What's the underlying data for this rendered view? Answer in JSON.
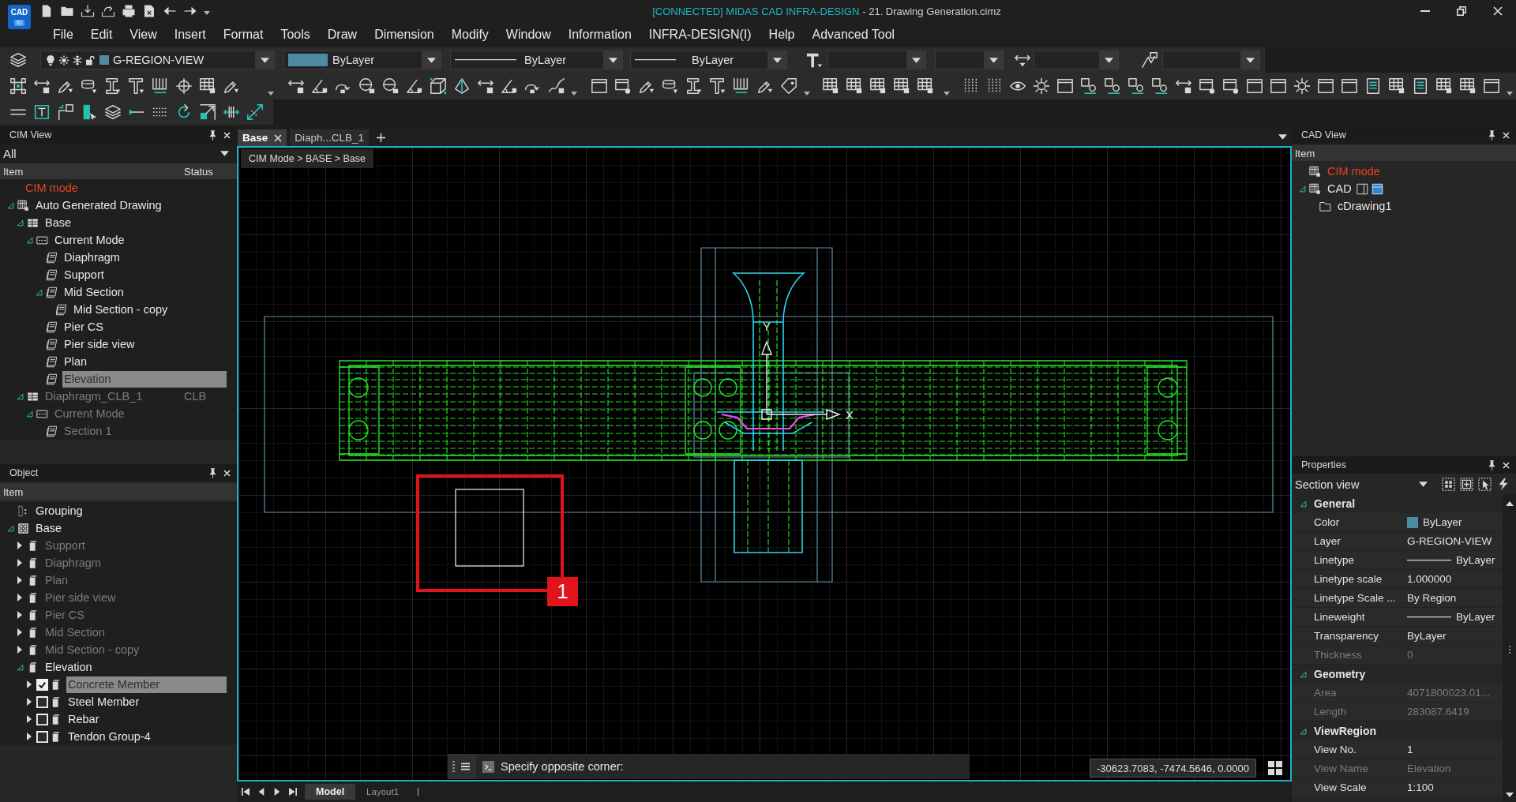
{
  "logo": {
    "text": "CAD",
    "subtext": "ID"
  },
  "window": {
    "app_title": "[CONNECTED] MIDAS CAD INFRA-DESIGN",
    "document_title": "- 21. Drawing Generation.cimz"
  },
  "menu": [
    "File",
    "Edit",
    "View",
    "Insert",
    "Format",
    "Tools",
    "Draw",
    "Dimension",
    "Modify",
    "Window",
    "Information",
    "INFRA-DESIGN(I)",
    "Help",
    "Advanced Tool"
  ],
  "style_toolbar": {
    "layer": "G-REGION-VIEW",
    "color_setting": "ByLayer",
    "linetype": "ByLayer",
    "lineweight": "ByLayer"
  },
  "cim_view": {
    "title": "CIM View",
    "filter": "All",
    "columns": [
      "Item",
      "Status"
    ],
    "items": [
      {
        "label": "CIM mode",
        "kind": "mode",
        "selected": false,
        "disabled": false
      },
      {
        "label": "Auto Generated Drawing",
        "kind": "drawing-set",
        "expanded": true,
        "selected": false,
        "disabled": false,
        "children": [
          {
            "label": "Base",
            "kind": "base",
            "expanded": true,
            "selected": false,
            "disabled": false,
            "children": [
              {
                "label": "Current Mode",
                "kind": "mode-folder",
                "expanded": true,
                "selected": false,
                "disabled": false,
                "children": [
                  {
                    "label": "Diaphragm",
                    "kind": "view",
                    "selected": false,
                    "disabled": false
                  },
                  {
                    "label": "Support",
                    "kind": "view",
                    "selected": false,
                    "disabled": false
                  },
                  {
                    "label": "Mid Section",
                    "kind": "view",
                    "expanded": true,
                    "selected": false,
                    "disabled": false,
                    "children": [
                      {
                        "label": "Mid Section - copy",
                        "kind": "view",
                        "selected": false,
                        "disabled": false
                      }
                    ]
                  },
                  {
                    "label": "Pier CS",
                    "kind": "view",
                    "selected": false,
                    "disabled": false
                  },
                  {
                    "label": "Pier side view",
                    "kind": "view",
                    "selected": false,
                    "disabled": false
                  },
                  {
                    "label": "Plan",
                    "kind": "view",
                    "selected": false,
                    "disabled": false
                  },
                  {
                    "label": "Elevation",
                    "kind": "view",
                    "selected": true,
                    "disabled": false
                  }
                ]
              }
            ]
          },
          {
            "label": "Diaphragm_CLB_1",
            "status": "CLB",
            "kind": "base",
            "expanded": true,
            "selected": false,
            "disabled": true,
            "children": [
              {
                "label": "Current Mode",
                "kind": "mode-folder",
                "expanded": true,
                "selected": false,
                "disabled": true,
                "children": [
                  {
                    "label": "Section 1",
                    "kind": "view",
                    "selected": false,
                    "disabled": true
                  }
                ]
              }
            ]
          }
        ]
      }
    ]
  },
  "object_panel": {
    "title": "Object",
    "columns": [
      "Item"
    ],
    "items": [
      {
        "label": "Grouping",
        "kind": "grouping",
        "selected": false,
        "disabled": false
      },
      {
        "label": "Base",
        "kind": "model",
        "expanded": true,
        "selected": false,
        "disabled": false,
        "children": [
          {
            "label": "Support",
            "kind": "object",
            "expanded": false,
            "selected": false,
            "disabled": true
          },
          {
            "label": "Diaphragm",
            "kind": "object",
            "expanded": false,
            "selected": false,
            "disabled": true
          },
          {
            "label": "Plan",
            "kind": "object",
            "expanded": false,
            "selected": false,
            "disabled": true
          },
          {
            "label": "Pier side view",
            "kind": "object",
            "expanded": false,
            "selected": false,
            "disabled": true
          },
          {
            "label": "Pier CS",
            "kind": "object",
            "expanded": false,
            "selected": false,
            "disabled": true
          },
          {
            "label": "Mid Section",
            "kind": "object",
            "expanded": false,
            "selected": false,
            "disabled": true
          },
          {
            "label": "Mid Section - copy",
            "kind": "object",
            "expanded": false,
            "selected": false,
            "disabled": true
          },
          {
            "label": "Elevation",
            "kind": "object",
            "expanded": true,
            "selected": false,
            "disabled": false,
            "children": [
              {
                "label": "Concrete Member",
                "kind": "object",
                "expanded": false,
                "checked": true,
                "selected": true,
                "disabled": false
              },
              {
                "label": "Steel Member",
                "kind": "object",
                "expanded": false,
                "checked": false,
                "selected": false,
                "disabled": false
              },
              {
                "label": "Rebar",
                "kind": "object",
                "expanded": false,
                "checked": false,
                "selected": false,
                "disabled": false
              },
              {
                "label": "Tendon Group-4",
                "kind": "object",
                "expanded": false,
                "checked": false,
                "selected": false,
                "disabled": false
              }
            ]
          }
        ]
      }
    ]
  },
  "document_tabs": [
    {
      "label": "Base",
      "selected": true
    },
    {
      "label": "Diaph...CLB_1",
      "selected": false
    }
  ],
  "canvas": {
    "breadcrumb": "CIM Mode > BASE > Base",
    "axis_y": "Y",
    "axis_x": "X",
    "callout_number": "1"
  },
  "command_line": {
    "prompt": "Specify opposite corner:"
  },
  "coordinates": "-30623.7083, -7474.5646, 0.0000",
  "layout_tabs": [
    {
      "label": "Model",
      "selected": true
    },
    {
      "label": "Layout1",
      "selected": false
    }
  ],
  "cad_view": {
    "title": "CAD View",
    "columns": [
      "Item"
    ],
    "items": [
      {
        "label": "CIM mode",
        "kind": "mode-link",
        "selected": false
      },
      {
        "label": "CAD",
        "kind": "cad",
        "expanded": true,
        "selected": false,
        "children": [
          {
            "label": "cDrawing1",
            "kind": "drawing",
            "selected": false
          }
        ]
      }
    ]
  },
  "properties": {
    "title": "Properties",
    "selector": "Section view",
    "sections": [
      {
        "title": "General",
        "expanded": true,
        "rows": [
          {
            "label": "Color",
            "value": "ByLayer",
            "kind": "color",
            "disabled": false
          },
          {
            "label": "Layer",
            "value": "G-REGION-VIEW",
            "kind": "text",
            "disabled": false
          },
          {
            "label": "Linetype",
            "value": "ByLayer",
            "kind": "line",
            "disabled": false
          },
          {
            "label": "Linetype scale",
            "value": "1.000000",
            "kind": "text",
            "disabled": false
          },
          {
            "label": "Linetype Scale ...",
            "value": "By Region",
            "kind": "text",
            "disabled": false
          },
          {
            "label": "Lineweight",
            "value": "ByLayer",
            "kind": "line",
            "disabled": false
          },
          {
            "label": "Transparency",
            "value": "ByLayer",
            "kind": "text",
            "disabled": false
          },
          {
            "label": "Thickness",
            "value": "0",
            "kind": "text",
            "disabled": true
          }
        ]
      },
      {
        "title": "Geometry",
        "expanded": true,
        "rows": [
          {
            "label": "Area",
            "value": "4071800023.01...",
            "kind": "text",
            "disabled": true
          },
          {
            "label": "Length",
            "value": "283087.6419",
            "kind": "text",
            "disabled": true
          }
        ]
      },
      {
        "title": "ViewRegion",
        "expanded": true,
        "rows": [
          {
            "label": "View No.",
            "value": "1",
            "kind": "text",
            "disabled": false
          },
          {
            "label": "View Name",
            "value": "Elevation",
            "kind": "text",
            "disabled": true
          },
          {
            "label": "View Scale",
            "value": "1:100",
            "kind": "text",
            "disabled": false
          }
        ]
      }
    ]
  }
}
